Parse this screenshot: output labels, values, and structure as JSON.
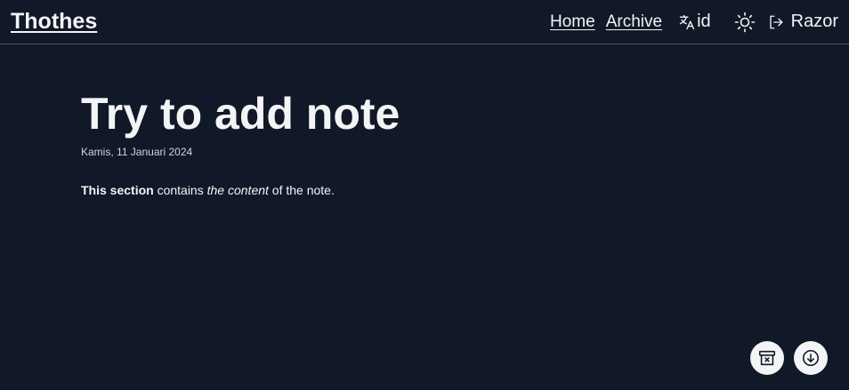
{
  "header": {
    "brand": "Thothes",
    "nav": {
      "home": "Home",
      "archive": "Archive"
    },
    "language": {
      "icon": "translate-icon",
      "code": "id"
    },
    "theme": {
      "icon": "sun-icon"
    },
    "user": {
      "icon": "logout-icon",
      "name": "Razor"
    }
  },
  "note": {
    "title": "Try to add note",
    "date": "Kamis, 11 Januari 2024",
    "body": {
      "bold": "This section",
      "text1": " contains ",
      "italic": "the content",
      "text2": " of the note."
    }
  },
  "actions": {
    "archive_icon": "archive-icon",
    "download_icon": "download-icon"
  },
  "colors": {
    "background": "#111827",
    "text": "#f3f4f6",
    "divider": "#4b5563",
    "fab_bg": "#f3f4f6",
    "fab_icon": "#111827"
  }
}
